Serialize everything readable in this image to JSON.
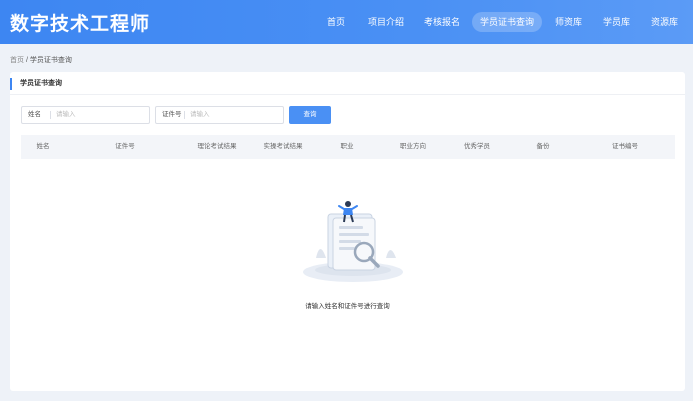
{
  "header": {
    "logo": "数字技术工程师",
    "nav": [
      {
        "label": "首页"
      },
      {
        "label": "项目介绍"
      },
      {
        "label": "考核报名"
      },
      {
        "label": "学员证书查询",
        "active": true
      },
      {
        "label": "师资库"
      },
      {
        "label": "学员库"
      },
      {
        "label": "资源库"
      }
    ]
  },
  "breadcrumb": {
    "home": "首页",
    "separator": " / ",
    "current": "学员证书查询"
  },
  "panel": {
    "title": "学员证书查询"
  },
  "search": {
    "name_label": "姓名",
    "name_placeholder": "请输入",
    "cert_label": "证件号",
    "cert_placeholder": "请输入",
    "button": "查询"
  },
  "table": {
    "columns": [
      "姓名",
      "证件号",
      "理论考试结果",
      "实操考试结果",
      "职业",
      "职业方向",
      "优秀学员",
      "备份",
      "证书编号"
    ]
  },
  "empty": {
    "message": "请输入姓名和证件号进行查询"
  },
  "colors": {
    "primary": "#3d86f2",
    "header_bg": "#4a90f4",
    "page_bg": "#eef2f8"
  }
}
